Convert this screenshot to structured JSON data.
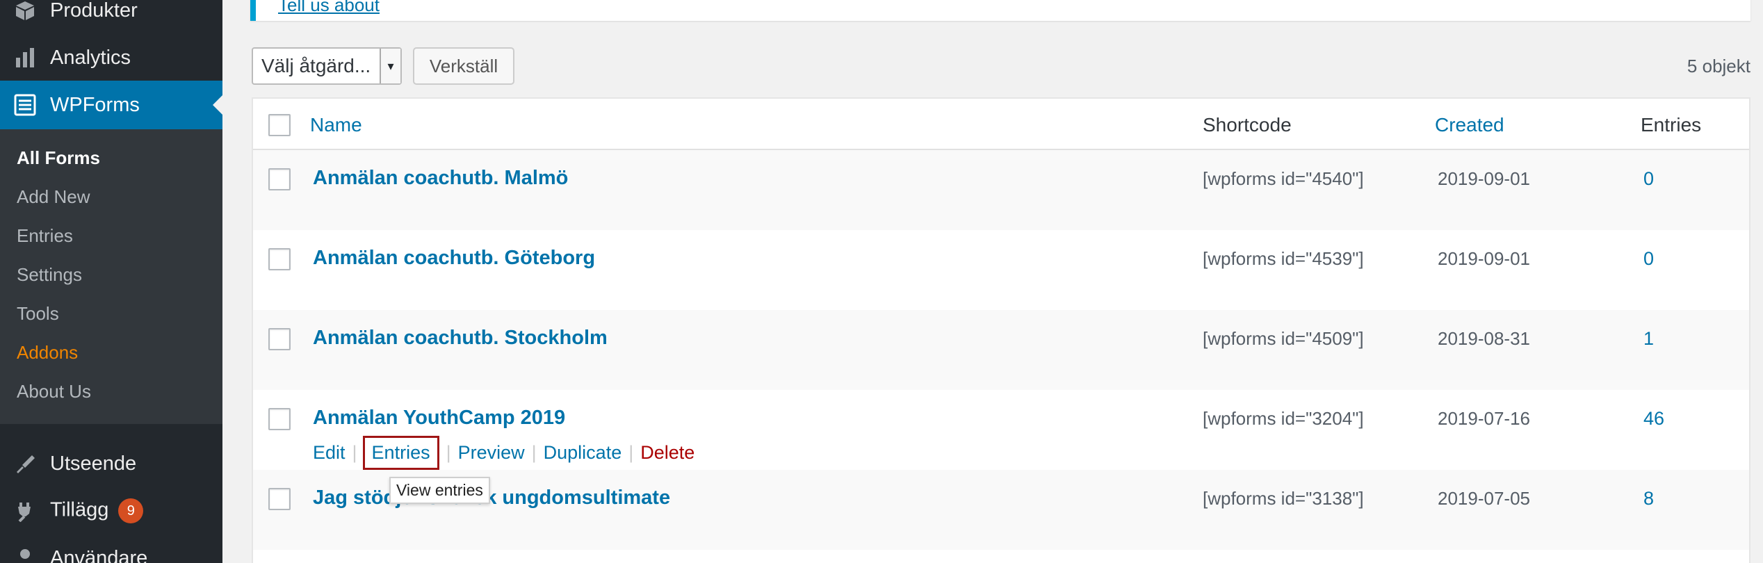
{
  "sidebar": {
    "products": "Produkter",
    "analytics": "Analytics",
    "wpforms": "WPForms",
    "submenu": [
      "All Forms",
      "Add New",
      "Entries",
      "Settings",
      "Tools",
      "Addons",
      "About Us"
    ],
    "utseende": "Utseende",
    "tillagg": "Tillägg",
    "tillagg_badge": "9",
    "anvandare": "Användare"
  },
  "notice": {
    "link_text": "Tell us about"
  },
  "toolbar": {
    "bulk_action": "Välj åtgärd...",
    "apply_label": "Verkställ",
    "item_count": "5 objekt"
  },
  "table": {
    "headers": {
      "name": "Name",
      "shortcode": "Shortcode",
      "created": "Created",
      "entries": "Entries"
    },
    "rows": [
      {
        "name": "Anmälan coachutb. Malmö",
        "shortcode": "[wpforms id=\"4540\"]",
        "created": "2019-09-01",
        "entries": "0"
      },
      {
        "name": "Anmälan coachutb. Göteborg",
        "shortcode": "[wpforms id=\"4539\"]",
        "created": "2019-09-01",
        "entries": "0"
      },
      {
        "name": "Anmälan coachutb. Stockholm",
        "shortcode": "[wpforms id=\"4509\"]",
        "created": "2019-08-31",
        "entries": "1"
      },
      {
        "name": "Anmälan YouthCamp 2019",
        "shortcode": "[wpforms id=\"3204\"]",
        "created": "2019-07-16",
        "entries": "46"
      },
      {
        "name": "Jag stödjer Svensk ungdomsultimate",
        "shortcode": "[wpforms id=\"3138\"]",
        "created": "2019-07-05",
        "entries": "8"
      }
    ],
    "row_actions": {
      "edit": "Edit",
      "entries": "Entries",
      "preview": "Preview",
      "duplicate": "Duplicate",
      "delete": "Delete",
      "sep": "|"
    },
    "tooltip": "View entries"
  },
  "colors": {
    "accent": "#0073aa",
    "sidebar_bg": "#23282d",
    "submenu_bg": "#32373c",
    "delete": "#aa0000",
    "addons": "#f18500"
  },
  "icons": [
    "products-icon",
    "analytics-icon",
    "wpforms-icon",
    "utseende-icon",
    "tillagg-icon",
    "anvandare-icon"
  ]
}
